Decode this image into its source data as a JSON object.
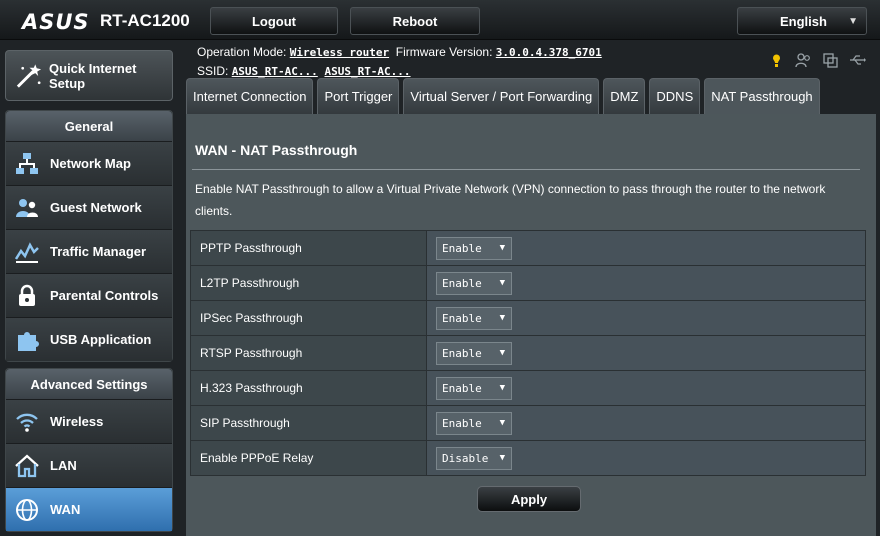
{
  "header": {
    "brand": "ASUS",
    "model": "RT-AC1200",
    "logout_label": "Logout",
    "reboot_label": "Reboot",
    "language": "English"
  },
  "status": {
    "op_mode_label": "Operation Mode:",
    "op_mode_value": "Wireless router",
    "firmware_label": "Firmware Version:",
    "firmware_value": "3.0.0.4.378_6701",
    "ssid_label": "SSID:",
    "ssid_1": "ASUS_RT-AC...",
    "ssid_2": "ASUS_RT-AC..."
  },
  "sidebar": {
    "qis_label": "Quick Internet Setup",
    "general_header": "General",
    "general_items": [
      {
        "label": "Network Map",
        "icon": "network-map-icon"
      },
      {
        "label": "Guest Network",
        "icon": "guest-network-icon"
      },
      {
        "label": "Traffic Manager",
        "icon": "traffic-manager-icon"
      },
      {
        "label": "Parental Controls",
        "icon": "lock-icon"
      },
      {
        "label": "USB Application",
        "icon": "puzzle-icon"
      }
    ],
    "advanced_header": "Advanced Settings",
    "advanced_items": [
      {
        "label": "Wireless",
        "icon": "wifi-icon"
      },
      {
        "label": "LAN",
        "icon": "home-icon"
      },
      {
        "label": "WAN",
        "icon": "globe-icon",
        "active": true
      }
    ]
  },
  "tabs": [
    {
      "label": "Internet Connection"
    },
    {
      "label": "Port Trigger"
    },
    {
      "label": "Virtual Server / Port Forwarding"
    },
    {
      "label": "DMZ"
    },
    {
      "label": "DDNS"
    },
    {
      "label": "NAT Passthrough",
      "active": true
    }
  ],
  "main": {
    "title": "WAN - NAT Passthrough",
    "description": "Enable NAT Passthrough to allow a Virtual Private Network (VPN) connection to pass through the router to the network clients.",
    "options": [
      {
        "name": "PPTP Passthrough",
        "value": "Enable"
      },
      {
        "name": "L2TP Passthrough",
        "value": "Enable"
      },
      {
        "name": "IPSec Passthrough",
        "value": "Enable"
      },
      {
        "name": "RTSP Passthrough",
        "value": "Enable"
      },
      {
        "name": "H.323 Passthrough",
        "value": "Enable"
      },
      {
        "name": "SIP Passthrough",
        "value": "Enable"
      },
      {
        "name": "Enable PPPoE Relay",
        "value": "Disable"
      }
    ],
    "apply_label": "Apply"
  },
  "colors": {
    "active_menu": "#3f86c6",
    "panel_bg": "#4d575b",
    "status_icon_yellow": "#f2c200"
  }
}
